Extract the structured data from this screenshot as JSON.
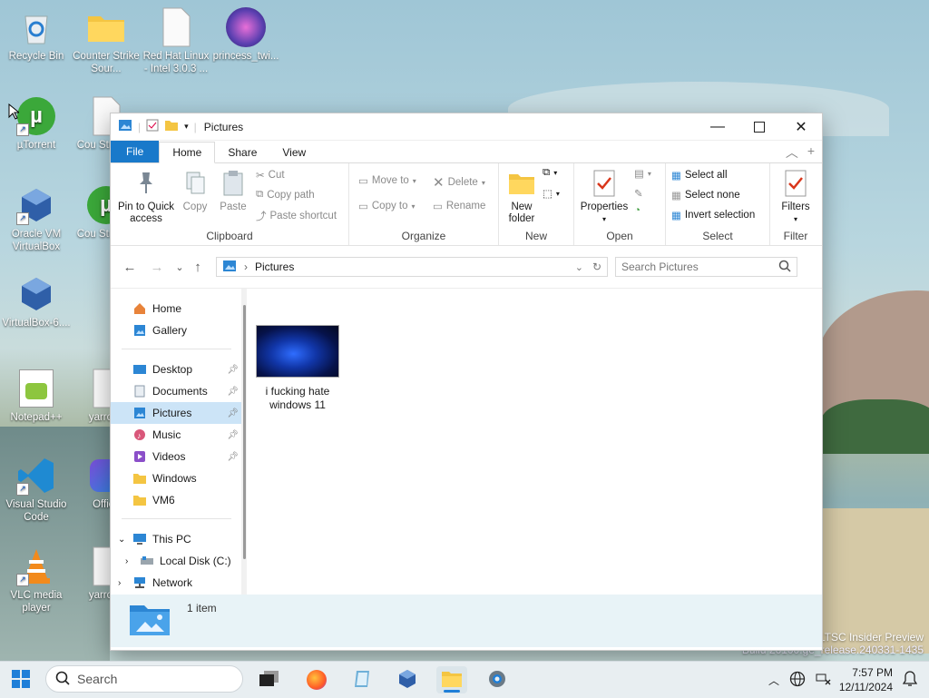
{
  "desktop": {
    "icons": [
      {
        "label": "Recycle Bin"
      },
      {
        "label": "Counter Strike Sour..."
      },
      {
        "label": "Red Hat Linux - Intel 3.0.3 ..."
      },
      {
        "label": "princess_twi..."
      },
      {
        "label": "µTorrent"
      },
      {
        "label": "Cou Strike S"
      },
      {
        "label": "Oracle VM VirtualBox"
      },
      {
        "label": "Cou Strike S"
      },
      {
        "label": "VirtualBox-6...."
      },
      {
        "label": "Notepad++"
      },
      {
        "label": "yarrow-"
      },
      {
        "label": "Visual Studio Code"
      },
      {
        "label": "Office"
      },
      {
        "label": "VLC media player"
      },
      {
        "label": "yarrow-"
      }
    ],
    "watermark_line1": "e LTSC Insider Preview",
    "watermark_line2": "Build 26100.ge_release.240331-1435"
  },
  "window": {
    "title": "Pictures",
    "tabs": {
      "file": "File",
      "home": "Home",
      "share": "Share",
      "view": "View"
    },
    "ribbon": {
      "clipboard": {
        "pin": "Pin to Quick access",
        "copy": "Copy",
        "paste": "Paste",
        "cut": "Cut",
        "copy_path": "Copy path",
        "paste_shortcut": "Paste shortcut",
        "label": "Clipboard"
      },
      "organize": {
        "move_to": "Move to",
        "copy_to": "Copy to",
        "delete": "Delete",
        "rename": "Rename",
        "label": "Organize"
      },
      "new": {
        "new_folder": "New folder",
        "label": "New"
      },
      "open": {
        "properties": "Properties",
        "label": "Open"
      },
      "select": {
        "select_all": "Select all",
        "select_none": "Select none",
        "invert": "Invert selection",
        "label": "Select"
      },
      "filter": {
        "filters": "Filters",
        "label": "Filter"
      }
    },
    "address": {
      "path": "Pictures",
      "search_placeholder": "Search Pictures"
    },
    "nav": {
      "home": "Home",
      "gallery": "Gallery",
      "desktop": "Desktop",
      "documents": "Documents",
      "pictures": "Pictures",
      "music": "Music",
      "videos": "Videos",
      "windows": "Windows",
      "vm6": "VM6",
      "this_pc": "This PC",
      "local_disk": "Local Disk (C:)",
      "network": "Network"
    },
    "files": [
      {
        "name": "i fucking hate windows 11"
      }
    ],
    "status": "1 item"
  },
  "taskbar": {
    "search": "Search",
    "time": "7:57 PM",
    "date": "12/11/2024"
  }
}
